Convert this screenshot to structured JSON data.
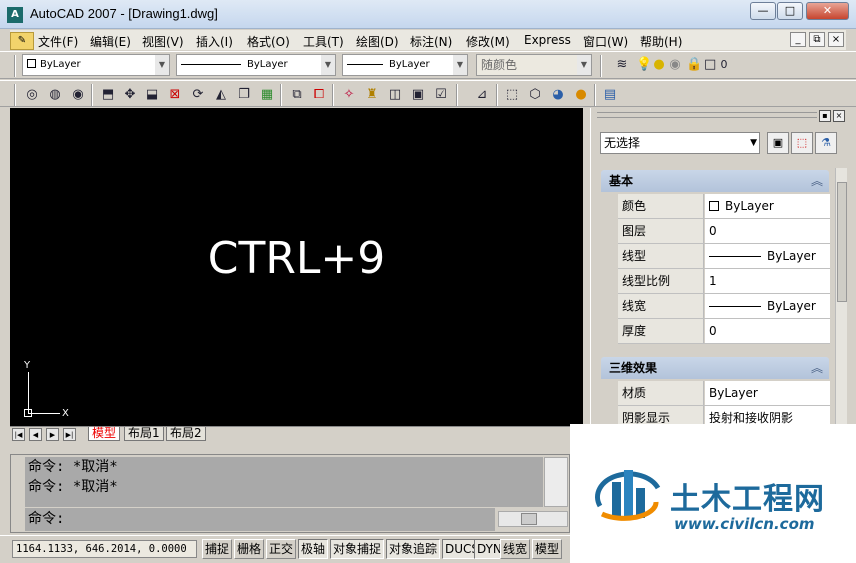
{
  "window": {
    "title": "AutoCAD 2007 - [Drawing1.dwg]",
    "app_icon_label": "A",
    "controls": {
      "minimize": "—",
      "maximize": "□",
      "close": "✕"
    }
  },
  "menubar": {
    "items": [
      "文件(F)",
      "编辑(E)",
      "视图(V)",
      "插入(I)",
      "格式(O)",
      "工具(T)",
      "绘图(D)",
      "标注(N)",
      "修改(M)",
      "Express",
      "窗口(W)",
      "帮助(H)"
    ],
    "doc_controls": {
      "minimize": "_",
      "restore": "⧉",
      "close": "×"
    }
  },
  "properties_toolbar": {
    "color_combo": "ByLayer",
    "linetype_combo": "ByLayer",
    "lineweight_combo": "ByLayer",
    "plotstyle_combo": "随颜色",
    "layer_value": "0"
  },
  "canvas": {
    "overlay_text": "CTRL+9",
    "ucs_y": "Y",
    "ucs_x": "X"
  },
  "layout_tabs": {
    "nav": [
      "|◀",
      "◀",
      "▶",
      "▶|"
    ],
    "tabs": [
      "模型",
      "布局1",
      "布局2"
    ],
    "active_index": 0
  },
  "properties_palette": {
    "selection": "无选择",
    "sections": [
      {
        "title": "基本",
        "rows": [
          {
            "name": "颜色",
            "value": "ByLayer"
          },
          {
            "name": "图层",
            "value": "0"
          },
          {
            "name": "线型",
            "value": "ByLayer"
          },
          {
            "name": "线型比例",
            "value": "1"
          },
          {
            "name": "线宽",
            "value": "ByLayer"
          },
          {
            "name": "厚度",
            "value": "0"
          }
        ]
      },
      {
        "title": "三维效果",
        "rows": [
          {
            "name": "材质",
            "value": "ByLayer"
          },
          {
            "name": "阴影显示",
            "value": "投射和接收阴影"
          }
        ]
      }
    ]
  },
  "command_line": {
    "history": [
      "命令: *取消*",
      "命令: *取消*"
    ],
    "prompt": "命令:"
  },
  "statusbar": {
    "coordinates": "1164.1133, 646.2014, 0.0000",
    "toggles": [
      "捕捉",
      "栅格",
      "正交",
      "极轴",
      "对象捕捉",
      "对象追踪",
      "DUCS",
      "DYN",
      "线宽",
      "模型"
    ]
  },
  "watermark": {
    "name": "土木工程网",
    "url": "www.civilcn.com"
  },
  "colors": {
    "canvas_background": "#000000",
    "active_tab_text": "#ee0000",
    "watermark_blue": "#1d6a9c"
  }
}
